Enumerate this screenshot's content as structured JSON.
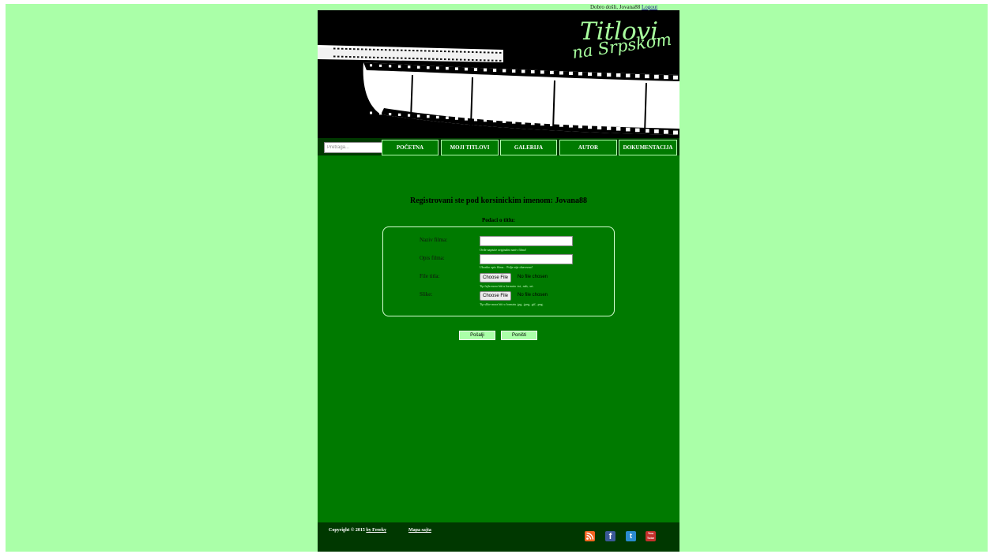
{
  "user_bar": {
    "greeting": "Dobro došli, Jovana88",
    "logout": "Logout"
  },
  "logo": {
    "line1": "Titlovi",
    "line2": "na Srpskom"
  },
  "search": {
    "placeholder": "Pretraga..."
  },
  "nav": {
    "items": [
      {
        "label": "POČETNA"
      },
      {
        "label": "MOJI TITLOVI"
      },
      {
        "label": "GALERIJA"
      },
      {
        "label": "AUTOR"
      },
      {
        "label": "DOKUMENTACIJA"
      }
    ]
  },
  "main": {
    "heading": "Registrovani ste pod korsinickim imenom: Jovana88",
    "subheading": "Podaci o titlu:",
    "fields": {
      "name": {
        "label": "Naziv filma:",
        "hint": "Ovde napisite originalni naziv filma!",
        "value": ""
      },
      "desc": {
        "label": "Opis filma:",
        "hint": "Ukratko opis filma... Polje nije obavezno!",
        "value": ""
      },
      "subtitle_file": {
        "label": "File titla:",
        "button": "Choose File",
        "status": "No file chosen",
        "hint": "Tip fajla mora biti u formatu .txt, .sub, .srt."
      },
      "images": {
        "label": "Slike:",
        "button": "Choose File",
        "status": "No file chosen",
        "hint": "Tip slike mora biti u formatu .jpg, .jpeg, .gif, .png."
      }
    },
    "send_button": "Pošalji",
    "reset_button": "Poništi"
  },
  "footer": {
    "copyright": "Copyright © 2015",
    "author_link": "by Freeky",
    "sitemap": "Mapa sajta",
    "social": [
      "rss-icon",
      "facebook-icon",
      "twitter-icon",
      "youtube-icon"
    ]
  },
  "colors": {
    "page_background": "#aaffa8",
    "content_green": "#007a00",
    "dark_green": "#003800",
    "logo_green": "#a8ff9e",
    "rss": "#f26522",
    "facebook": "#3b5998",
    "twitter": "#2a8bd0",
    "youtube": "#c4302b"
  }
}
